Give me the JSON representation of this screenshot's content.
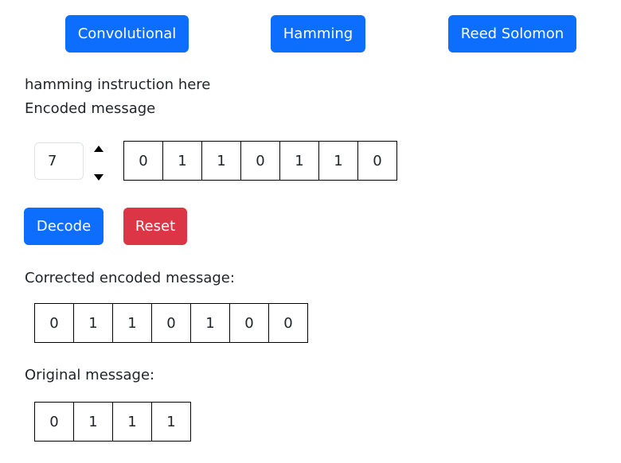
{
  "tabs": {
    "convolutional": "Convolutional",
    "hamming": "Hamming",
    "reed_solomon": "Reed Solomon"
  },
  "instruction": "hamming instruction here",
  "encoded_label": "Encoded message",
  "length_input": "7",
  "encoded_bits": [
    "0",
    "1",
    "1",
    "0",
    "1",
    "1",
    "0"
  ],
  "buttons": {
    "decode": "Decode",
    "reset": "Reset"
  },
  "corrected_label": "Corrected encoded message:",
  "corrected_bits": [
    "0",
    "1",
    "1",
    "0",
    "1",
    "0",
    "0"
  ],
  "original_label": "Original message:",
  "original_bits": [
    "0",
    "1",
    "1",
    "1"
  ],
  "colors": {
    "primary": "#0d6efd",
    "danger": "#dc3545"
  },
  "icons": {
    "spin_up": "triangle-up-icon",
    "spin_down": "triangle-down-icon"
  }
}
